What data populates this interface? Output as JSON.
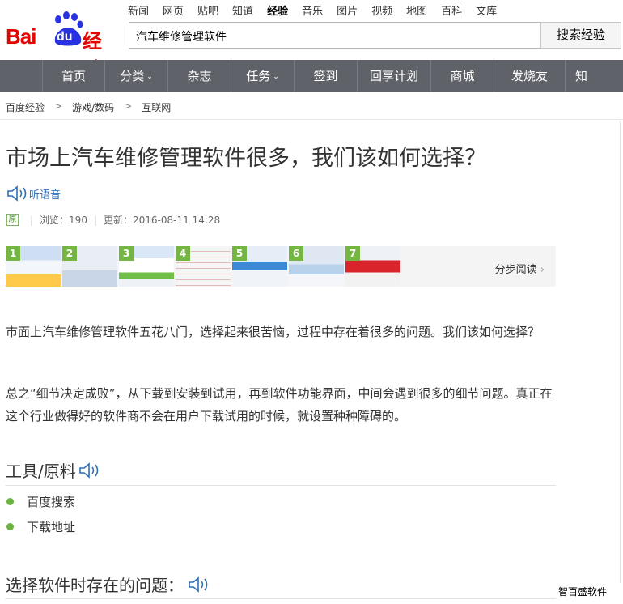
{
  "logo": {
    "bai": "Bai",
    "du": "du",
    "jy": "经验"
  },
  "top_nav": [
    "新闻",
    "网页",
    "贴吧",
    "知道",
    "经验",
    "音乐",
    "图片",
    "视频",
    "地图",
    "百科",
    "文库"
  ],
  "top_nav_active": "经验",
  "search": {
    "value": "汽车维修管理软件",
    "button": "搜索经验"
  },
  "main_nav": [
    {
      "label": "首页",
      "caret": false
    },
    {
      "label": "分类",
      "caret": true
    },
    {
      "label": "杂志",
      "caret": false
    },
    {
      "label": "任务",
      "caret": true
    },
    {
      "label": "签到",
      "caret": false
    },
    {
      "label": "回享计划",
      "caret": false
    },
    {
      "label": "商城",
      "caret": false
    },
    {
      "label": "发烧友",
      "caret": false
    },
    {
      "label": "知",
      "caret": false
    }
  ],
  "breadcrumb": [
    "百度经验",
    "游戏/数码",
    "互联网"
  ],
  "article": {
    "title": "市场上汽车维修管理软件很多，我们该如何选择？",
    "listen_label": "听语音",
    "original_badge": "原",
    "views_label": "浏览：190",
    "updated_label": "更新：2016-08-11 14:28",
    "step_numbers": [
      "1",
      "2",
      "3",
      "4",
      "5",
      "6",
      "7"
    ],
    "step_read_label": "分步阅读",
    "intro_1": "市面上汽车维修管理软件五花八门，选择起来很苦恼，过程中存在着很多的问题。我们该如何选择？",
    "intro_2": "总之“细节决定成败”，从下载到安装到试用，再到软件功能界面，中间会遇到很多的细节问题。真正在这个行业做得好的软件商不会在用户下载试用的时候，就设置种种障碍的。",
    "tools_heading": "工具/原料",
    "tools": [
      "百度搜索",
      "下载地址"
    ],
    "section2_heading": "选择软件时存在的问题："
  },
  "watermark": "智百盛软件",
  "colors": {
    "brand_red": "#e10602",
    "nav_bg": "#5f6268",
    "link_blue": "#2d6fb5",
    "bullet_green": "#6cb33f"
  }
}
